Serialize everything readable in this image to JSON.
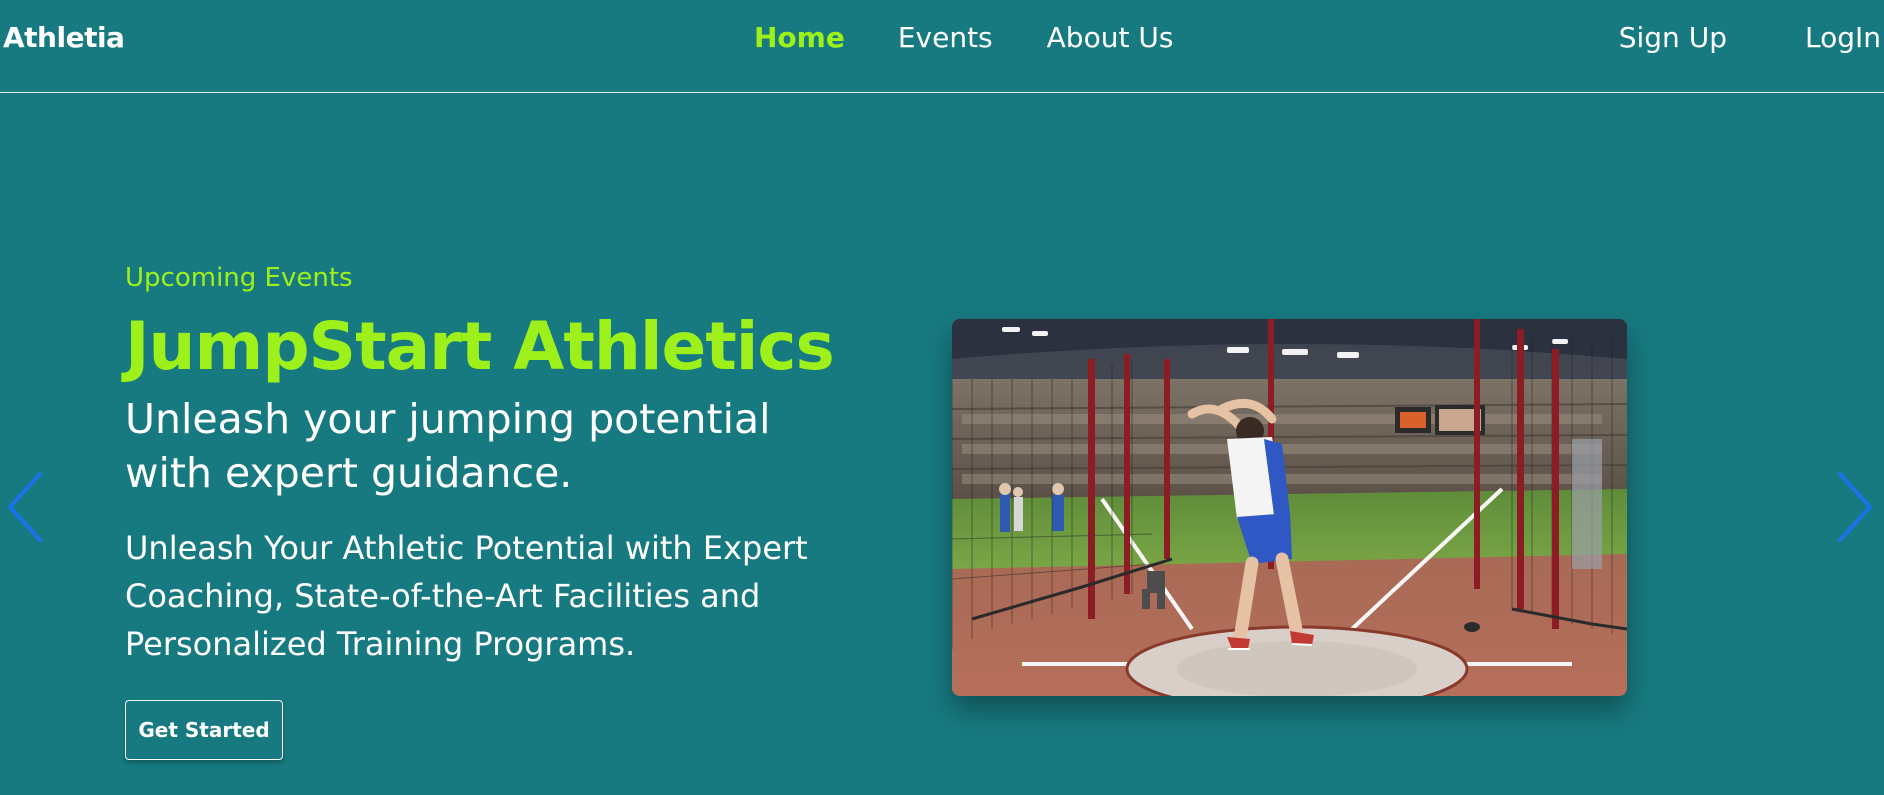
{
  "navbar": {
    "brand": "Athletia",
    "links": [
      {
        "label": "Home",
        "active": true
      },
      {
        "label": "Events",
        "active": false
      },
      {
        "label": "About Us",
        "active": false
      }
    ],
    "signup_label": "Sign Up",
    "login_label": "LogIn"
  },
  "hero": {
    "eyebrow": "Upcoming Events",
    "title": "JumpStart Athletics",
    "subtitle": "Unleash your jumping potential with expert guidance.",
    "description": "Unleash Your Athletic Potential with Expert Coaching, State-of-the-Art Facilities and Personalized Training Programs.",
    "cta_label": "Get Started"
  },
  "carousel": {
    "prev_icon": "chevron-left-icon",
    "next_icon": "chevron-right-icon"
  },
  "colors": {
    "background": "#177a80",
    "accent": "#9ef01a",
    "arrow": "#1a73e8",
    "text": "#ffffff"
  }
}
